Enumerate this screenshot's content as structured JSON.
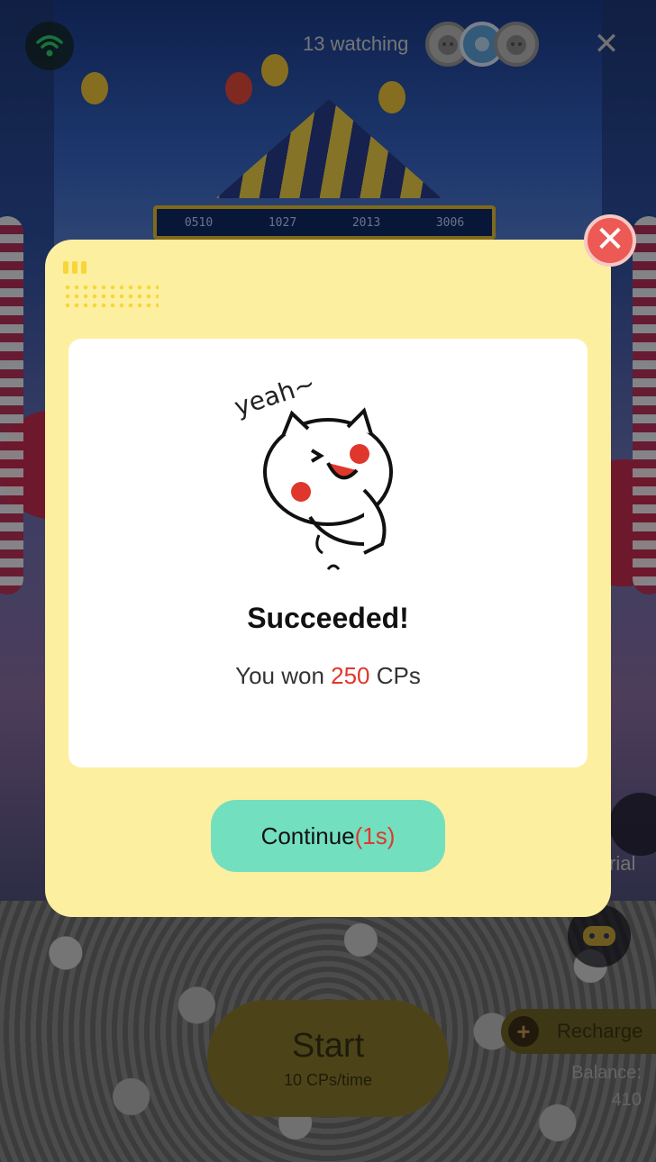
{
  "top_bar": {
    "watching_count": "13 watching",
    "avatar_count": 3
  },
  "machine": {
    "screen_values": [
      "0510",
      "1027",
      "2013",
      "3006"
    ]
  },
  "controls": {
    "start_label": "Start",
    "start_cost": "10 CPs/time",
    "recharge_label": "Recharge",
    "recharge_plus": "+",
    "balance_label": "Balance:",
    "balance_value": "410",
    "tutorial_label": "rial"
  },
  "modal": {
    "mascot_caption": "yeah~",
    "title": "Succeeded!",
    "message_prefix": "You won ",
    "amount": "250",
    "message_suffix": " CPs",
    "continue_label": "Continue",
    "countdown": "(1s)",
    "close_glyph": "✕"
  },
  "colors": {
    "modal_bg": "#fdefa0",
    "continue_bg": "#72dfbe",
    "highlight_red": "#e0372c",
    "close_red": "#ed5a55"
  }
}
